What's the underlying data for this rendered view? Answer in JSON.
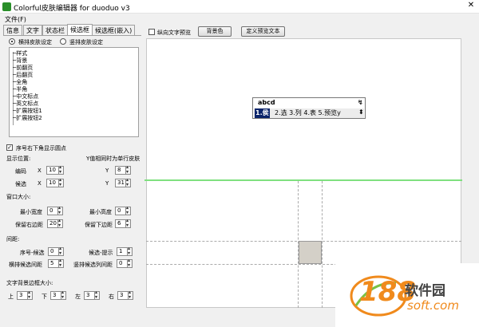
{
  "window": {
    "title": "Colorful皮肤编辑器 for duoduo v3",
    "close_glyph": "✕"
  },
  "menu": {
    "file": "文件(F)"
  },
  "tabs": [
    "信息",
    "文字",
    "状态栏",
    "候选框",
    "候选框(嵌入)"
  ],
  "active_tab": 3,
  "layout_options": {
    "horizontal": "横排皮肤设定",
    "vertical": "竖排皮肤设定"
  },
  "tree": [
    "样式",
    "背景",
    "前翻页",
    "后翻页",
    "全角",
    "半角",
    "中文标点",
    "英文标点",
    "扩展按钮1",
    "扩展按钮2"
  ],
  "show_dot": {
    "label": "序号右下角显示圆点",
    "checked": true
  },
  "position": {
    "title": "显示位置:",
    "note": "Y值相同时为单行皮肤",
    "rows": [
      {
        "label": "编码",
        "x": "10",
        "y": "8"
      },
      {
        "label": "候选",
        "x": "10",
        "y": "31"
      }
    ],
    "x_label": "X",
    "y_label": "Y"
  },
  "window_size": {
    "title": "窗口大小:",
    "min_width_label": "最小宽度",
    "min_width": "0",
    "min_height_label": "最小高度",
    "min_height": "0",
    "keep_right_label": "保留右边距",
    "keep_right": "20",
    "keep_bottom_label": "保留下边距",
    "keep_bottom": "6"
  },
  "spacing": {
    "title": "间距:",
    "index_cand_label": "序号-候选",
    "index_cand": "0",
    "cand_hint_label": "候选-提示",
    "cand_hint": "1",
    "horiz_gap_label": "横排候选间距",
    "horiz_gap": "5",
    "vert_gap_label": "竖排候选列间距",
    "vert_gap": "0"
  },
  "text_bg": {
    "title": "文字背景边框大小:",
    "top_label": "上",
    "top": "3",
    "bottom_label": "下",
    "bottom": "3",
    "left_label": "左",
    "left": "3",
    "right_label": "右",
    "right": "3"
  },
  "toolbar": {
    "vertical_preview": "纵向文字预览",
    "vertical_preview_checked": false,
    "bg_color": "背景色",
    "custom_text": "定义预览文本"
  },
  "candidate_window": {
    "code": "abcd",
    "selected": "1.侯",
    "rest": "2.选 3.列 4.表 5.预览y",
    "page_glyph": "↯",
    "scroll_glyph": "⬍"
  },
  "watermark": {
    "number": "188",
    "name": "软件园",
    "domain": "soft.com"
  },
  "colors": {
    "accent_green": "#7fe07f",
    "selection_blue": "#0a246a",
    "watermark_orange": "#f08a1c"
  }
}
